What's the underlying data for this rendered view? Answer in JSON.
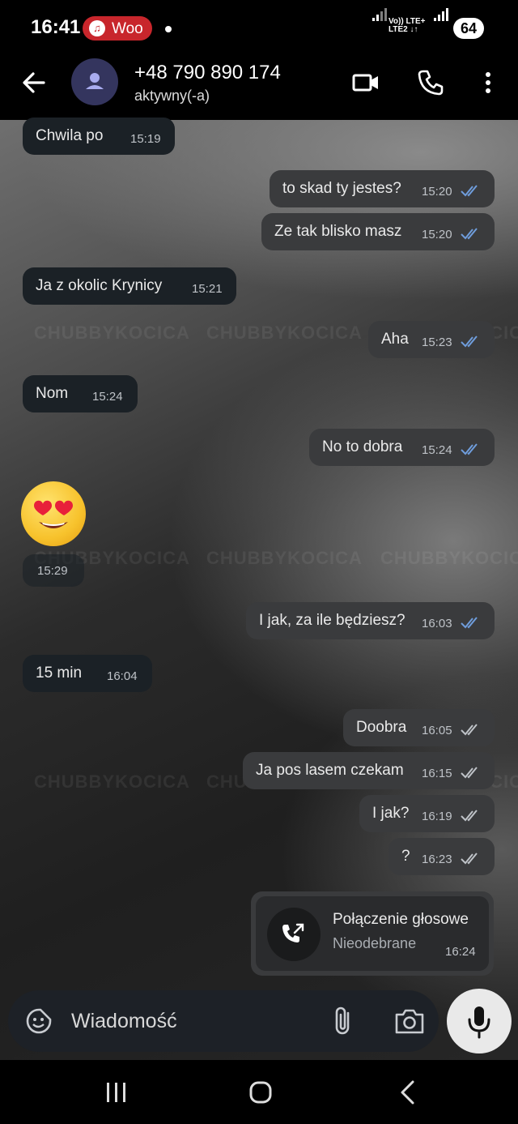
{
  "status_bar": {
    "time": "16:41",
    "pill_label": "Woo",
    "network_top": "Vo)) LTE+",
    "network_bottom": "LTE2 ↓↑",
    "battery": "64"
  },
  "header": {
    "contact": "+48 790 890 174",
    "status": "aktywny(-a)",
    "icons": [
      "back-arrow-icon",
      "avatar-person-icon",
      "video-call-icon",
      "phone-icon",
      "more-vertical-icon"
    ]
  },
  "watermark": "CHUBBYKOCICA",
  "messages": [
    {
      "dir": "in",
      "text": "Chwila po",
      "time": "15:19"
    },
    {
      "dir": "out",
      "text": "to skad ty jestes?",
      "time": "15:20",
      "read": true
    },
    {
      "dir": "out",
      "text": "Ze tak blisko masz",
      "time": "15:20",
      "read": true
    },
    {
      "dir": "in",
      "text": "Ja z okolic Krynicy",
      "time": "15:21"
    },
    {
      "dir": "out",
      "text": "Aha",
      "time": "15:23",
      "read": true
    },
    {
      "dir": "in",
      "text": "Nom",
      "time": "15:24"
    },
    {
      "dir": "out",
      "text": "No to dobra",
      "time": "15:24",
      "read": true
    },
    {
      "dir": "in",
      "text": "😍",
      "time": "15:29",
      "emoji": true
    },
    {
      "dir": "out",
      "text": "I jak, za ile będziesz?",
      "time": "16:03",
      "read": true
    },
    {
      "dir": "in",
      "text": "15 min",
      "time": "16:04"
    },
    {
      "dir": "out",
      "text": "Doobra",
      "time": "16:05",
      "read": false
    },
    {
      "dir": "out",
      "text": "Ja pos lasem czekam",
      "time": "16:15",
      "read": false
    },
    {
      "dir": "out",
      "text": "I jak?",
      "time": "16:19",
      "read": false
    },
    {
      "dir": "out",
      "text": "?",
      "time": "16:23",
      "read": false
    }
  ],
  "call": {
    "title": "Połączenie głosowe",
    "subtitle": "Nieodebrane",
    "time": "16:24"
  },
  "composer": {
    "placeholder": "Wiadomość"
  },
  "colors": {
    "incoming_bubble": "#1b2126",
    "outgoing_bubble": "#3a3b3d",
    "read_ticks": "#6f9ddc",
    "unread_ticks": "#bfc3c8",
    "pill": "#c8262c"
  }
}
